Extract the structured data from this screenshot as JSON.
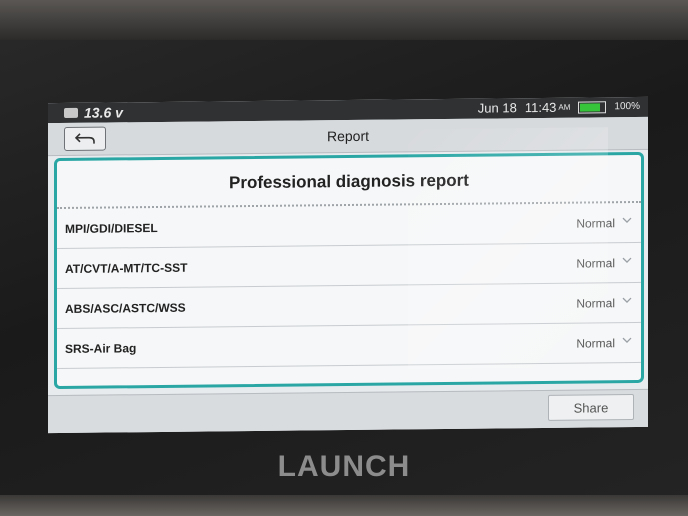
{
  "status_bar": {
    "voltage": "13.6 v",
    "date": "Jun 18",
    "time": "11:43",
    "ampm": "AM",
    "battery_percent": "100%",
    "battery_color": "#35c43a"
  },
  "title_bar": {
    "back_icon": "back-arrow-icon",
    "title": "Report"
  },
  "report": {
    "heading": "Professional diagnosis report",
    "items": [
      {
        "system": "MPI/GDI/DIESEL",
        "status": "Normal"
      },
      {
        "system": "AT/CVT/A-MT/TC-SST",
        "status": "Normal"
      },
      {
        "system": "ABS/ASC/ASTC/WSS",
        "status": "Normal"
      },
      {
        "system": "SRS-Air Bag",
        "status": "Normal"
      }
    ]
  },
  "bottom_bar": {
    "share_label": "Share"
  },
  "device": {
    "brand": "LAUNCH",
    "accent_color": "#2aa7a5"
  }
}
